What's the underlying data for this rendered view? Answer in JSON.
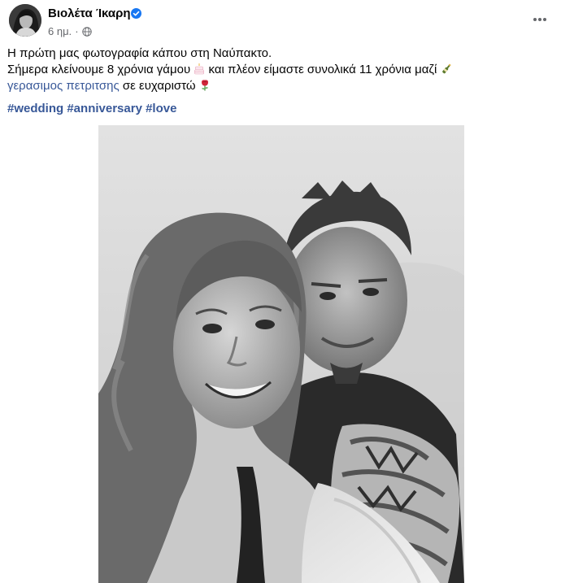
{
  "post": {
    "author_name": "Βιολέτα Ίκαρη",
    "verified": true,
    "timestamp": "6 ημ.",
    "separator": "·",
    "audience_icon": "globe-icon",
    "more_icon": "more-horizontal-icon",
    "text_line_1": "Η πρώτη μας φωτογραφία κάπου στη Ναύπακτο.",
    "text_line_2_part_1": "Σήμερα κλείνουμε 8 χρόνια γάμου ",
    "text_line_2_part_2": " και πλέον είμαστε συνολικά 11 χρόνια μαζί ",
    "text_line_3_mention": "γερασιμος πετριτσης",
    "text_line_3_rest": " σε ευχαριστώ ",
    "hashtags": [
      "#wedding",
      "#anniversary",
      "#love"
    ],
    "emojis": [
      "birthday-cake-icon",
      "champagne-bottle-icon",
      "rose-icon"
    ],
    "photo_icon": "couple-selfie-photo"
  },
  "colors": {
    "text": "#050505",
    "secondary_text": "#65676b",
    "link": "#385898",
    "verified": "#1877f2"
  }
}
